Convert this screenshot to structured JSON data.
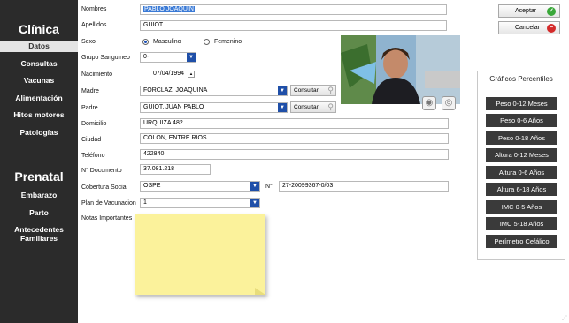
{
  "sidebar": {
    "section_clinica": "Clínica",
    "items_clinica": [
      "Datos",
      "Consultas",
      "Vacunas",
      "Alimentación",
      "Hitos motores",
      "Patologías"
    ],
    "active_item": "Datos",
    "section_prenatal": "Prenatal",
    "items_prenatal": [
      "Embarazo",
      "Parto",
      "Antecedentes Familiares"
    ]
  },
  "form": {
    "nombres_label": "Nombres",
    "nombres_value": "PABLO JOAQUIN",
    "apellidos_label": "Apellidos",
    "apellidos_value": "GUIOT",
    "sexo_label": "Sexo",
    "sexo_options": [
      "Masculino",
      "Femenino"
    ],
    "sexo_selected": "Masculino",
    "grupo_label": "Grupo Sanguineo",
    "grupo_value": "0-",
    "nacimiento_label": "Nacimiento",
    "nacimiento_value": "07/04/1994",
    "madre_label": "Madre",
    "madre_value": "FORCLAZ, JOAQUINA",
    "padre_label": "Padre",
    "padre_value": "GUIOT, JUAN PABLO",
    "consultar_label": "Consultar",
    "domicilio_label": "Domicilio",
    "domicilio_value": "URQUIZA 482",
    "ciudad_label": "Ciudad",
    "ciudad_value": "COLON, ENTRE RIOS",
    "telefono_label": "Teléfono",
    "telefono_value": "422840",
    "documento_label": "N° Documento",
    "documento_value": "37.081.218",
    "cobertura_label": "Cobertura Social",
    "cobertura_value": "OSPE",
    "numero_label": "N°",
    "numero_value": "27-20099367-0/03",
    "plan_label": "Plan de Vacunacion",
    "plan_value": "1",
    "notas_label": "Notas Importantes"
  },
  "actions": {
    "aceptar": "Aceptar",
    "cancelar": "Cancelar",
    "aceptar_color": "#3aa83a",
    "cancelar_color": "#d42a2a"
  },
  "percentiles": {
    "title": "Gráficos Percentiles",
    "buttons": [
      "Peso 0-12 Meses",
      "Peso 0-6 Años",
      "Peso 0-18 Años",
      "Altura 0-12 Meses",
      "Altura 0-6 Años",
      "Altura 6-18 Años",
      "IMC 0-5 Años",
      "IMC 5-18 Años",
      "Perímetro Cefálico"
    ]
  }
}
